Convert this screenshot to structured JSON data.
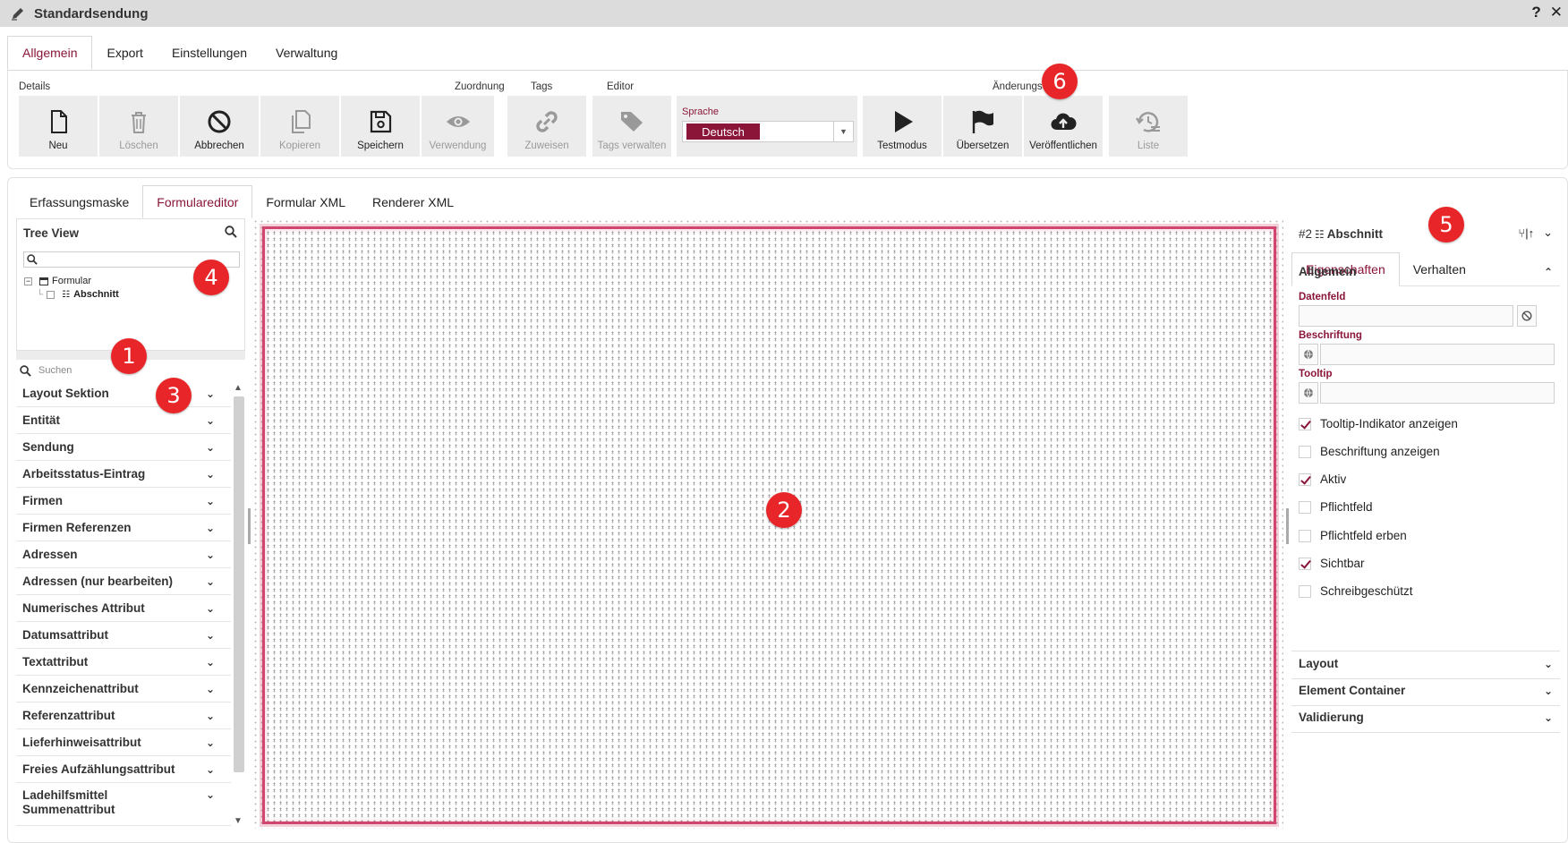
{
  "window": {
    "title": "Standardsendung",
    "help": "?",
    "close": "✕"
  },
  "main_tabs": [
    {
      "label": "Allgemein",
      "active": true
    },
    {
      "label": "Export",
      "active": false
    },
    {
      "label": "Einstellungen",
      "active": false
    },
    {
      "label": "Verwaltung",
      "active": false
    }
  ],
  "ribbon": {
    "groups": {
      "details": "Details",
      "zuordnung": "Zuordnung",
      "tags": "Tags",
      "editor": "Editor",
      "aenderung": "Änderungsverlauf"
    },
    "buttons": {
      "neu": "Neu",
      "loeschen": "Löschen",
      "abbrechen": "Abbrechen",
      "kopieren": "Kopieren",
      "speichern": "Speichern",
      "verwendung": "Verwendung",
      "zuweisen": "Zuweisen",
      "tags_verwalten": "Tags verwalten",
      "testmodus": "Testmodus",
      "uebersetzen": "Übersetzen",
      "veroeffentlichen": "Veröffentlichen",
      "liste": "Liste"
    },
    "sprache_label": "Sprache",
    "sprache_value": "Deutsch"
  },
  "sub_tabs": [
    {
      "label": "Erfassungsmaske",
      "active": false
    },
    {
      "label": "Formulareditor",
      "active": true
    },
    {
      "label": "Formular XML",
      "active": false
    },
    {
      "label": "Renderer XML",
      "active": false
    }
  ],
  "tree": {
    "title": "Tree View",
    "root": "Formular",
    "child": "Abschnitt"
  },
  "palette": {
    "search_placeholder": "Suchen",
    "items": [
      "Layout Sektion",
      "Entität",
      "Sendung",
      "Arbeitsstatus-Eintrag",
      "Firmen",
      "Firmen Referenzen",
      "Adressen",
      "Adressen (nur bearbeiten)",
      "Numerisches Attribut",
      "Datumsattribut",
      "Textattribut",
      "Kennzeichenattribut",
      "Referenzattribut",
      "Lieferhinweisattribut",
      "Freies Aufzählungsattribut"
    ],
    "last_item_line1": "Ladehilfsmittel",
    "last_item_line2": "Summenattribut"
  },
  "properties": {
    "id": "#2",
    "type": "Abschnitt",
    "tabs": [
      {
        "label": "Eigenschaften",
        "active": true
      },
      {
        "label": "Verhalten",
        "active": false
      }
    ],
    "section_allgemein": "Allgemein",
    "fields": {
      "datenfeld": "Datenfeld",
      "beschriftung": "Beschriftung",
      "tooltip": "Tooltip"
    },
    "checkboxes": [
      {
        "label": "Tooltip-Indikator anzeigen",
        "checked": true
      },
      {
        "label": "Beschriftung anzeigen",
        "checked": false
      },
      {
        "label": "Aktiv",
        "checked": true
      },
      {
        "label": "Pflichtfeld",
        "checked": false
      },
      {
        "label": "Pflichtfeld erben",
        "checked": false
      },
      {
        "label": "Sichtbar",
        "checked": true
      },
      {
        "label": "Schreibgeschützt",
        "checked": false
      }
    ],
    "sections_collapsed": [
      "Layout",
      "Element Container",
      "Validierung"
    ]
  },
  "badges": [
    "1",
    "2",
    "3",
    "4",
    "5",
    "6"
  ],
  "colors": {
    "accent": "#8a1538",
    "badge": "#e8262a",
    "canvas_border": "#d0466f"
  }
}
